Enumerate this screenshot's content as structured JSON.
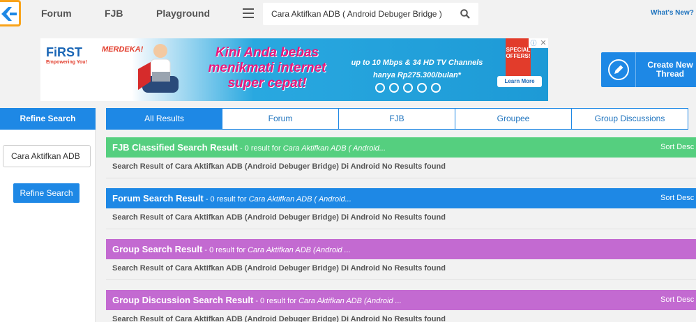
{
  "nav": {
    "links": [
      "Forum",
      "FJB",
      "Playground"
    ],
    "search_value": "Cara Aktifkan ADB ( Android Debuger Bridge )",
    "whats_new": "What's New?"
  },
  "banner": {
    "brand": "FiRST",
    "brand_tag": "Empowering You!",
    "merdeka": "MERDEKA!",
    "headline": "Kini Anda bebas menikmati internet super cepat!",
    "speed": "up to 10 Mbps & 34 HD TV Channels",
    "price": "hanya Rp275.300/bulan*",
    "special": "SPECIAL OFFERS!",
    "learn_more": "Learn More"
  },
  "create_thread": "Create New Thread",
  "sidebar": {
    "header": "Refine Search",
    "input_value": "Cara Aktifkan ADB",
    "button": "Refine Search"
  },
  "tabs": [
    "All Results",
    "Forum",
    "FJB",
    "Groupee",
    "Group Discussions"
  ],
  "sections": [
    {
      "title": "FJB Classified Search Result",
      "count": " - 0 result for ",
      "query": "Cara Aktifkan ADB ( Android...",
      "sort": "Sort Desc",
      "body": "Search Result of Cara Aktifkan ADB (Android Debuger Bridge) Di Android No Results found"
    },
    {
      "title": "Forum Search Result",
      "count": " - 0 result for ",
      "query": "Cara Aktifkan ADB ( Android...",
      "sort": "Sort Desc",
      "body": "Search Result of Cara Aktifkan ADB (Android Debuger Bridge) Di Android No Results found"
    },
    {
      "title": "Group Search Result",
      "count": " - 0 result for ",
      "query": "Cara Aktifkan ADB (Android ...",
      "sort": "",
      "body": "Search Result of Cara Aktifkan ADB (Android Debuger Bridge) Di Android No Results found"
    },
    {
      "title": "Group Discussion Search Result",
      "count": " - 0 result for ",
      "query": "Cara Aktifkan ADB (Android ...",
      "sort": "Sort Desc",
      "body": "Search Result of Cara Aktifkan ADB (Android Debuger Bridge) Di Android No Results found"
    }
  ],
  "colors": {
    "accent": "#1e88e5",
    "fjb": "#55cf7f",
    "group": "#c36ad1",
    "logo_border": "#f9a31b"
  }
}
